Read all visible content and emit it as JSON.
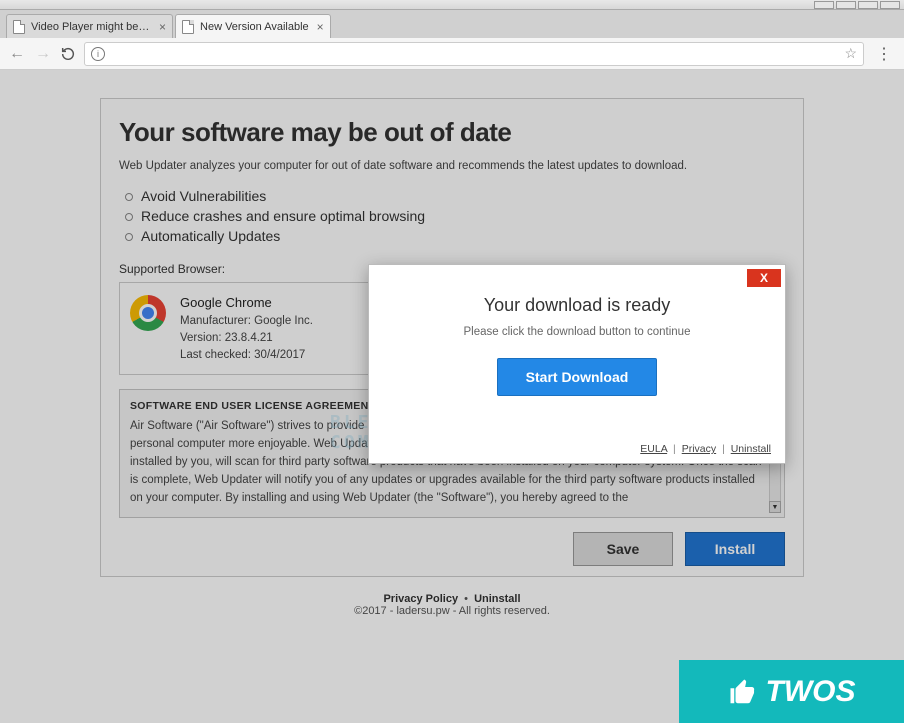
{
  "window": {
    "tabs": [
      {
        "title": "Video Player might be o...",
        "active": false
      },
      {
        "title": "New Version Available",
        "active": true
      }
    ]
  },
  "page": {
    "heading": "Your software may be out of date",
    "subtext": "Web Updater analyzes your computer for out of date software and recommends the latest updates to download.",
    "bullets": [
      "Avoid Vulnerabilities",
      "Reduce crashes and ensure optimal browsing",
      "Automatically Updates"
    ],
    "supported_label": "Supported Browser:",
    "browser": {
      "name": "Google Chrome",
      "manufacturer_label": "Manufacturer: Google Inc.",
      "version_label": "Version: 23.8.4.21",
      "last_checked_label": "Last checked: 30/4/2017"
    },
    "eula": {
      "title": "SOFTWARE END USER LICENSE AGREEMENT",
      "text": "Air Software (\"Air Software\") strives to provide exceptional software products that help to make the experience with your personal computer more enjoyable. Web Updater is a software product created by Air Software that, once downloaded and installed by you, will scan for third party software products that have been installed on your computer system. Once the scan is complete, Web Updater will notify you of any updates or upgrades available for the third party software products installed on your computer. By installing and using Web Updater (the \"Software\"), you hereby agreed to the"
    },
    "buttons": {
      "save": "Save",
      "install": "Install"
    },
    "footer": {
      "privacy": "Privacy Policy",
      "uninstall": "Uninstall",
      "copyright": "©2017 - ladersu.pw - All rights reserved."
    }
  },
  "modal": {
    "title": "Your download is ready",
    "message": "Please click the download button to continue",
    "button": "Start Download",
    "links": {
      "eula": "EULA",
      "privacy": "Privacy",
      "uninstall": "Uninstall"
    },
    "close": "X"
  },
  "watermark": {
    "line1": "BLEEPING",
    "line2": "COMPUTER"
  },
  "brand": {
    "text": "TWOS"
  }
}
